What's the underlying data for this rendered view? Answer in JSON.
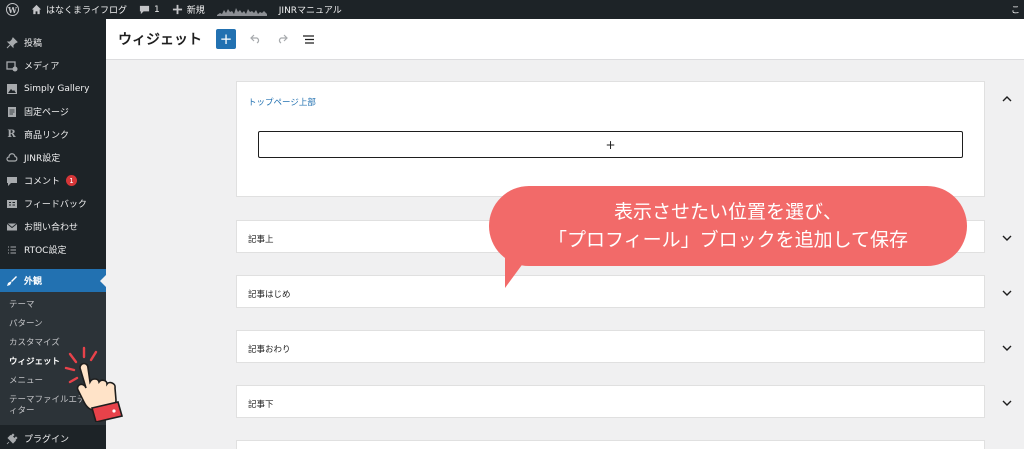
{
  "admin_bar": {
    "site_name": "はなくまライフログ",
    "comments_count": "1",
    "new_label": "新規",
    "manual_label": "JINRマニュアル",
    "right_text": "こ"
  },
  "sidebar": {
    "items": [
      {
        "label": "投稿",
        "icon": "pin-icon"
      },
      {
        "label": "メディア",
        "icon": "media-icon"
      },
      {
        "label": "Simply Gallery",
        "icon": "gallery-icon"
      },
      {
        "label": "固定ページ",
        "icon": "page-icon"
      },
      {
        "label": "商品リンク",
        "icon": "r-icon"
      },
      {
        "label": "JINR設定",
        "icon": "cloud-icon"
      },
      {
        "label": "コメント",
        "icon": "comment-icon",
        "badge": "1"
      },
      {
        "label": "フィードバック",
        "icon": "feedback-icon"
      },
      {
        "label": "お問い合わせ",
        "icon": "mail-icon"
      },
      {
        "label": "RTOC設定",
        "icon": "list-icon"
      }
    ],
    "active": {
      "label": "外観",
      "icon": "brush-icon"
    },
    "submenu": [
      "テーマ",
      "パターン",
      "カスタマイズ",
      "ウィジェット",
      "メニュー",
      "テーマファイルエディター"
    ],
    "current_submenu": "ウィジェット",
    "after": {
      "label": "プラグイン",
      "icon": "plugin-icon"
    }
  },
  "header": {
    "title": "ウィジェット",
    "add_label": "+"
  },
  "widget_areas": [
    {
      "title": "トップページ上部",
      "expanded": true
    },
    {
      "title": "記事上",
      "expanded": false
    },
    {
      "title": "記事はじめ",
      "expanded": false
    },
    {
      "title": "記事おわり",
      "expanded": false
    },
    {
      "title": "記事下",
      "expanded": false
    }
  ],
  "appender_label": "+",
  "callout": {
    "line1": "表示させたい位置を選び、",
    "line2": "「プロフィール」ブロックを追加して保存"
  },
  "colors": {
    "accent": "#2271b1",
    "callout": "#f26a69",
    "admin_dark": "#1d2327"
  }
}
